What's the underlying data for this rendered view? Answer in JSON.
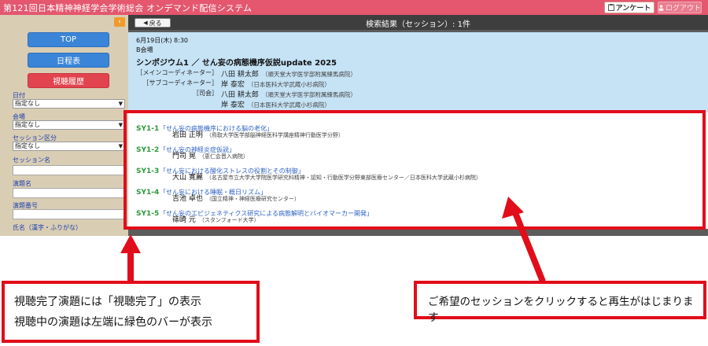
{
  "header": {
    "title": "第121回日本精神神経学会学術総会 オンデマンド配信システム",
    "enquete_label": "アンケート",
    "logout_label": "ログアウト"
  },
  "sidebar": {
    "collapse_icon": "chevron-left-icon",
    "buttons": {
      "top": "TOP",
      "schedule": "日程表",
      "history": "視聴履歴"
    },
    "fields": {
      "date": {
        "label": "日付",
        "value": "指定なし"
      },
      "venue": {
        "label": "会場",
        "value": "指定なし"
      },
      "session_type": {
        "label": "セッション区分",
        "value": "指定なし"
      },
      "session_name": {
        "label": "セッション名"
      },
      "talk_title": {
        "label": "演題名"
      },
      "talk_number": {
        "label": "演題番号"
      },
      "person_name": {
        "label": "氏名（漢字・ふりがな）"
      }
    }
  },
  "main": {
    "back_label": "戻る",
    "result_title": "検索結果（セッション）: 1件",
    "session": {
      "datetime": "6月19日(木) 8:30",
      "venue": "B会場",
      "title": "シンポジウム1 ／ せん妄の病態機序仮説update 2025",
      "roles": [
        {
          "role": "［メインコーディネーター］",
          "name": "八田 耕太郎",
          "aff": "（順天堂大学医学部附属練馬病院）"
        },
        {
          "role": "［サブコーディネーター］",
          "name": "岸 泰宏",
          "aff": "（日本医科大学武蔵小杉病院）"
        },
        {
          "role": "［司会］",
          "name": "八田 耕太郎",
          "aff": "（順天堂大学医学部附属練馬病院）"
        },
        {
          "role": "",
          "name": "岸 泰宏",
          "aff": "（日本医科大学武蔵小杉病院）"
        }
      ]
    },
    "talks": [
      {
        "code": "SY1-1",
        "title": "「せん妄の病態機序における脳の老化」",
        "speaker": "岩田 正明",
        "aff": "（鳥取大学医学部脳神経医科学講座精神行動医学分野）"
      },
      {
        "code": "SY1-2",
        "title": "「せん妄の神経炎症仮説」",
        "speaker": "門司 晃",
        "aff": "（恵仁会晋入病院）"
      },
      {
        "code": "SY1-3",
        "title": "「せん妄における酸化ストレスの役割とその制御」",
        "speaker": "大山 寛麗",
        "aff": "（名古屋市立大学大学院医学研究科精神・認知・行動医学分野東部医療センター／日本医科大学武蔵小杉病院）"
      },
      {
        "code": "SY1-4",
        "title": "「せん妄における睡眠・概日リズム」",
        "speaker": "吉池 卓也",
        "aff": "（国立精神・神経医療研究センター）"
      },
      {
        "code": "SY1-5",
        "title": "「せん妄のエピジェネティクス研究による病態解明とバイオマーカー開発」",
        "speaker": "篠崎 元",
        "aff": "（スタンフォード大学）"
      }
    ]
  },
  "annotations": {
    "left_line1": "視聴完了演題には「視聴完了」の表示",
    "left_line2": "視聴中の演題は左端に緑色のバーが表示",
    "right_text": "ご希望のセッションをクリックすると再生がはじまります",
    "accent_color": "#e20d1a"
  }
}
